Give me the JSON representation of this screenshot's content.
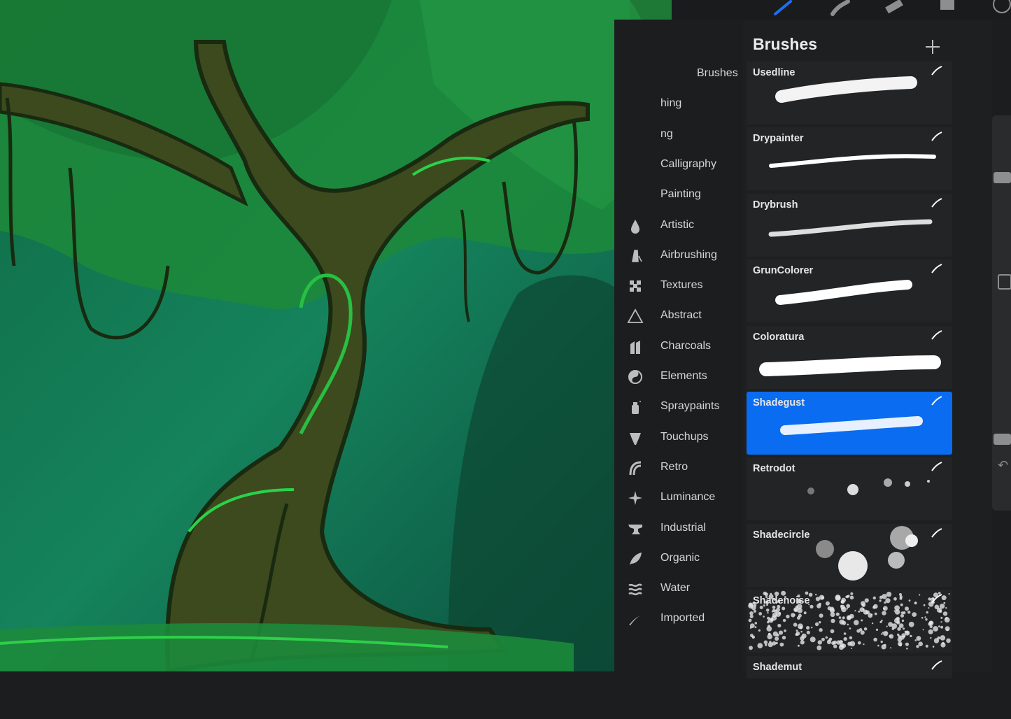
{
  "panel": {
    "title": "Brushes",
    "add_icon": "plus-icon"
  },
  "toolbar": {
    "tools": [
      "brush-icon",
      "smudge-icon",
      "eraser-icon",
      "layers-icon",
      "color-icon"
    ],
    "active_color": "#1e6ff0"
  },
  "brush_sets": [
    {
      "label": "Brushes",
      "icon": "none",
      "visible_label": "e Brushes"
    },
    {
      "label": "hing",
      "icon": "none"
    },
    {
      "label": "ng",
      "icon": "none"
    },
    {
      "label": "Calligraphy",
      "icon": "none"
    },
    {
      "label": "Painting",
      "icon": "none"
    },
    {
      "label": "Artistic",
      "icon": "ink-drop-icon"
    },
    {
      "label": "Airbrushing",
      "icon": "airbrush-icon"
    },
    {
      "label": "Textures",
      "icon": "checker-icon"
    },
    {
      "label": "Abstract",
      "icon": "triangle-icon"
    },
    {
      "label": "Charcoals",
      "icon": "charcoal-icon"
    },
    {
      "label": "Elements",
      "icon": "yin-yang-icon"
    },
    {
      "label": "Spraypaints",
      "icon": "spraycan-icon"
    },
    {
      "label": "Touchups",
      "icon": "touchup-icon"
    },
    {
      "label": "Retro",
      "icon": "rainbow-icon"
    },
    {
      "label": "Luminance",
      "icon": "sparkle-icon"
    },
    {
      "label": "Industrial",
      "icon": "anvil-icon"
    },
    {
      "label": "Organic",
      "icon": "leaf-icon"
    },
    {
      "label": "Water",
      "icon": "waves-icon"
    },
    {
      "label": "Imported",
      "icon": "feather-icon"
    }
  ],
  "brushes": [
    {
      "name": "Usedline",
      "selected": false
    },
    {
      "name": "Drypainter",
      "selected": false
    },
    {
      "name": "Drybrush",
      "selected": false
    },
    {
      "name": "GrunColorer",
      "selected": false
    },
    {
      "name": "Coloratura",
      "selected": false
    },
    {
      "name": "Shadegust",
      "selected": true
    },
    {
      "name": "Retrodot",
      "selected": false
    },
    {
      "name": "Shadecircle",
      "selected": false
    },
    {
      "name": "Shadenoise",
      "selected": false
    },
    {
      "name": "Shademut",
      "selected": false
    }
  ],
  "colors": {
    "selection": "#0a6cf0",
    "panel_bg": "#1e1f21"
  }
}
